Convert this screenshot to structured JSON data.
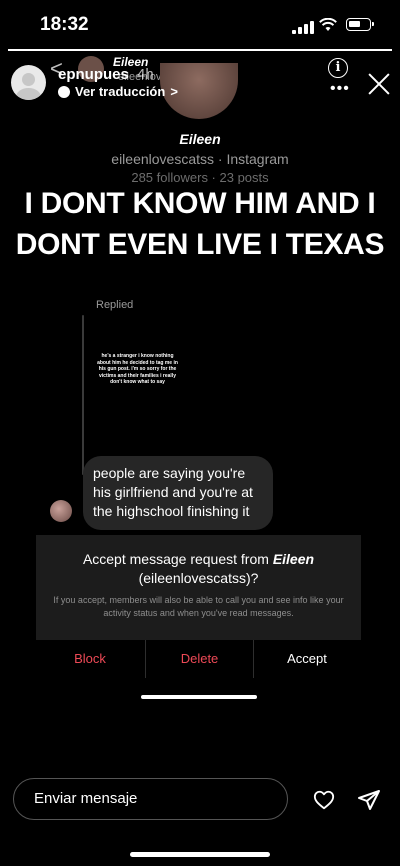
{
  "status_bar": {
    "time": "18:32",
    "battery_level": 0.6
  },
  "story_progress": 1.0,
  "story_header": {
    "username": "epnupues",
    "time_ago": "4h",
    "translate_label": "Ver traducción",
    "translate_chevron": ">"
  },
  "background_profile": {
    "back_glyph": "<",
    "header_name": "Eileen",
    "header_handle": "eileenlovescatss",
    "display_name": "Eileen",
    "subtitle": "eileenlovescatss · Instagram",
    "stats": "285 followers · 23 posts"
  },
  "headline": "I DONT KNOW HIM AND I DONT EVEN LIVE I TEXAS",
  "replied_label": "Replied",
  "story_thumb_text": "he's a stranger i know nothing about him he decided to tag me in his gun post. i'm so sorry for the victims and their families i really don't know what to say",
  "message": "people are saying you're his girlfriend and you're at the highschool finishing it",
  "request": {
    "title_prefix": "Accept message request from",
    "name": "Eileen",
    "handle": "(eileenlovescatss)?",
    "description": "If you accept, members will also be able to call you and see info like your activity status and when you've read messages.",
    "block_label": "Block",
    "delete_label": "Delete",
    "accept_label": "Accept"
  },
  "footer": {
    "message_placeholder": "Enviar mensaje"
  },
  "icons": {
    "info": "info-icon",
    "more": "more-icon",
    "close": "close-icon",
    "heart": "heart-icon",
    "send": "send-icon",
    "globe": "globe-icon"
  },
  "colors": {
    "destructive": "#ed4956",
    "bubble": "#262626"
  }
}
